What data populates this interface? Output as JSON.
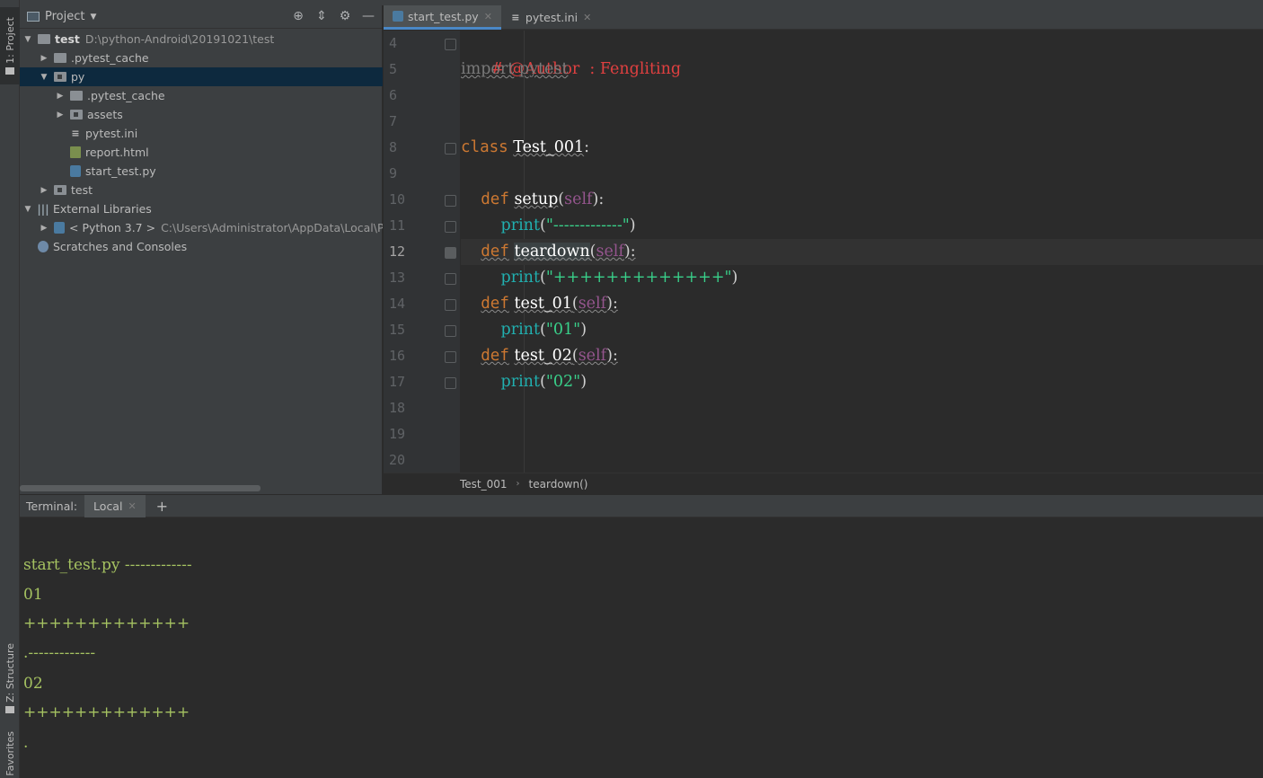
{
  "left_strip": {
    "project_tab": "1: Project",
    "structure_tab": "Z: Structure",
    "favorites_tab": "Favorites"
  },
  "project_panel": {
    "title": "Project",
    "tree": [
      {
        "label": "test",
        "path": "D:\\python-Android\\20191021\\test",
        "expanded": true
      },
      {
        "label": ".pytest_cache"
      },
      {
        "label": "py",
        "expanded": true,
        "selected": true
      },
      {
        "label": ".pytest_cache"
      },
      {
        "label": "assets"
      },
      {
        "label": "pytest.ini"
      },
      {
        "label": "report.html"
      },
      {
        "label": "start_test.py"
      },
      {
        "label": "test"
      },
      {
        "label": "External Libraries",
        "expanded": true
      },
      {
        "label": "< Python 3.7 >",
        "path": "C:\\Users\\Administrator\\AppData\\Local\\Prog"
      },
      {
        "label": "Scratches and Consoles"
      }
    ]
  },
  "editor": {
    "tabs": [
      {
        "label": "start_test.py",
        "active": true
      },
      {
        "label": "pytest.ini",
        "active": false
      }
    ],
    "line_numbers": [
      "4",
      "5",
      "6",
      "7",
      "8",
      "9",
      "10",
      "11",
      "12",
      "13",
      "14",
      "15",
      "16",
      "17",
      "18",
      "19",
      "20"
    ],
    "current_line": "12",
    "code": {
      "l4_comment": "# @Author  : Fengliting",
      "l5_import": "import",
      "l5_module": "pytest",
      "l8_class_kw": "class",
      "l8_class_name": "Test_001",
      "l8_colon": ":",
      "def_kw": "def",
      "self_kw": "self",
      "print_kw": "print",
      "l10_fn": "setup",
      "l11_str": "\"-------------\"",
      "l12_fn": "teardown",
      "l13_str": "\"+++++++++++++\"",
      "l14_fn": "test_01",
      "l15_str": "\"01\"",
      "l16_fn": "test_02",
      "l17_str": "\"02\"",
      "open_paren": "(",
      "close_paren_colon": "):",
      "close_paren": ")"
    },
    "breadcrumb": {
      "class": "Test_001",
      "method": "teardown()"
    }
  },
  "terminal": {
    "label": "Terminal:",
    "tab": "Local",
    "lines": [
      "start_test.py -------------",
      "01",
      "+++++++++++++",
      ".-------------",
      "02",
      "+++++++++++++",
      "."
    ]
  }
}
